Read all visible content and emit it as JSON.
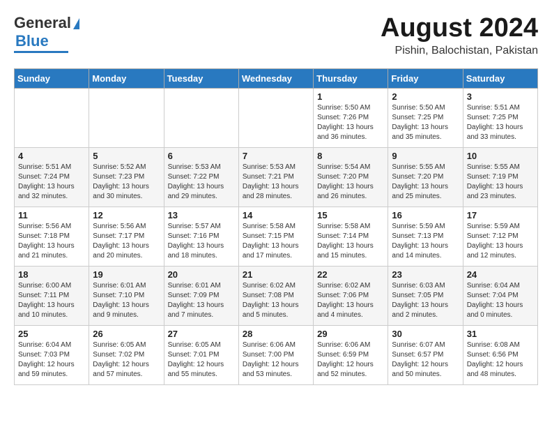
{
  "header": {
    "logo_general": "General",
    "logo_blue": "Blue",
    "month_year": "August 2024",
    "location": "Pishin, Balochistan, Pakistan"
  },
  "days_of_week": [
    "Sunday",
    "Monday",
    "Tuesday",
    "Wednesday",
    "Thursday",
    "Friday",
    "Saturday"
  ],
  "weeks": [
    [
      {
        "day": "",
        "content": ""
      },
      {
        "day": "",
        "content": ""
      },
      {
        "day": "",
        "content": ""
      },
      {
        "day": "",
        "content": ""
      },
      {
        "day": "1",
        "content": "Sunrise: 5:50 AM\nSunset: 7:26 PM\nDaylight: 13 hours\nand 36 minutes."
      },
      {
        "day": "2",
        "content": "Sunrise: 5:50 AM\nSunset: 7:25 PM\nDaylight: 13 hours\nand 35 minutes."
      },
      {
        "day": "3",
        "content": "Sunrise: 5:51 AM\nSunset: 7:25 PM\nDaylight: 13 hours\nand 33 minutes."
      }
    ],
    [
      {
        "day": "4",
        "content": "Sunrise: 5:51 AM\nSunset: 7:24 PM\nDaylight: 13 hours\nand 32 minutes."
      },
      {
        "day": "5",
        "content": "Sunrise: 5:52 AM\nSunset: 7:23 PM\nDaylight: 13 hours\nand 30 minutes."
      },
      {
        "day": "6",
        "content": "Sunrise: 5:53 AM\nSunset: 7:22 PM\nDaylight: 13 hours\nand 29 minutes."
      },
      {
        "day": "7",
        "content": "Sunrise: 5:53 AM\nSunset: 7:21 PM\nDaylight: 13 hours\nand 28 minutes."
      },
      {
        "day": "8",
        "content": "Sunrise: 5:54 AM\nSunset: 7:20 PM\nDaylight: 13 hours\nand 26 minutes."
      },
      {
        "day": "9",
        "content": "Sunrise: 5:55 AM\nSunset: 7:20 PM\nDaylight: 13 hours\nand 25 minutes."
      },
      {
        "day": "10",
        "content": "Sunrise: 5:55 AM\nSunset: 7:19 PM\nDaylight: 13 hours\nand 23 minutes."
      }
    ],
    [
      {
        "day": "11",
        "content": "Sunrise: 5:56 AM\nSunset: 7:18 PM\nDaylight: 13 hours\nand 21 minutes."
      },
      {
        "day": "12",
        "content": "Sunrise: 5:56 AM\nSunset: 7:17 PM\nDaylight: 13 hours\nand 20 minutes."
      },
      {
        "day": "13",
        "content": "Sunrise: 5:57 AM\nSunset: 7:16 PM\nDaylight: 13 hours\nand 18 minutes."
      },
      {
        "day": "14",
        "content": "Sunrise: 5:58 AM\nSunset: 7:15 PM\nDaylight: 13 hours\nand 17 minutes."
      },
      {
        "day": "15",
        "content": "Sunrise: 5:58 AM\nSunset: 7:14 PM\nDaylight: 13 hours\nand 15 minutes."
      },
      {
        "day": "16",
        "content": "Sunrise: 5:59 AM\nSunset: 7:13 PM\nDaylight: 13 hours\nand 14 minutes."
      },
      {
        "day": "17",
        "content": "Sunrise: 5:59 AM\nSunset: 7:12 PM\nDaylight: 13 hours\nand 12 minutes."
      }
    ],
    [
      {
        "day": "18",
        "content": "Sunrise: 6:00 AM\nSunset: 7:11 PM\nDaylight: 13 hours\nand 10 minutes."
      },
      {
        "day": "19",
        "content": "Sunrise: 6:01 AM\nSunset: 7:10 PM\nDaylight: 13 hours\nand 9 minutes."
      },
      {
        "day": "20",
        "content": "Sunrise: 6:01 AM\nSunset: 7:09 PM\nDaylight: 13 hours\nand 7 minutes."
      },
      {
        "day": "21",
        "content": "Sunrise: 6:02 AM\nSunset: 7:08 PM\nDaylight: 13 hours\nand 5 minutes."
      },
      {
        "day": "22",
        "content": "Sunrise: 6:02 AM\nSunset: 7:06 PM\nDaylight: 13 hours\nand 4 minutes."
      },
      {
        "day": "23",
        "content": "Sunrise: 6:03 AM\nSunset: 7:05 PM\nDaylight: 13 hours\nand 2 minutes."
      },
      {
        "day": "24",
        "content": "Sunrise: 6:04 AM\nSunset: 7:04 PM\nDaylight: 13 hours\nand 0 minutes."
      }
    ],
    [
      {
        "day": "25",
        "content": "Sunrise: 6:04 AM\nSunset: 7:03 PM\nDaylight: 12 hours\nand 59 minutes."
      },
      {
        "day": "26",
        "content": "Sunrise: 6:05 AM\nSunset: 7:02 PM\nDaylight: 12 hours\nand 57 minutes."
      },
      {
        "day": "27",
        "content": "Sunrise: 6:05 AM\nSunset: 7:01 PM\nDaylight: 12 hours\nand 55 minutes."
      },
      {
        "day": "28",
        "content": "Sunrise: 6:06 AM\nSunset: 7:00 PM\nDaylight: 12 hours\nand 53 minutes."
      },
      {
        "day": "29",
        "content": "Sunrise: 6:06 AM\nSunset: 6:59 PM\nDaylight: 12 hours\nand 52 minutes."
      },
      {
        "day": "30",
        "content": "Sunrise: 6:07 AM\nSunset: 6:57 PM\nDaylight: 12 hours\nand 50 minutes."
      },
      {
        "day": "31",
        "content": "Sunrise: 6:08 AM\nSunset: 6:56 PM\nDaylight: 12 hours\nand 48 minutes."
      }
    ]
  ]
}
